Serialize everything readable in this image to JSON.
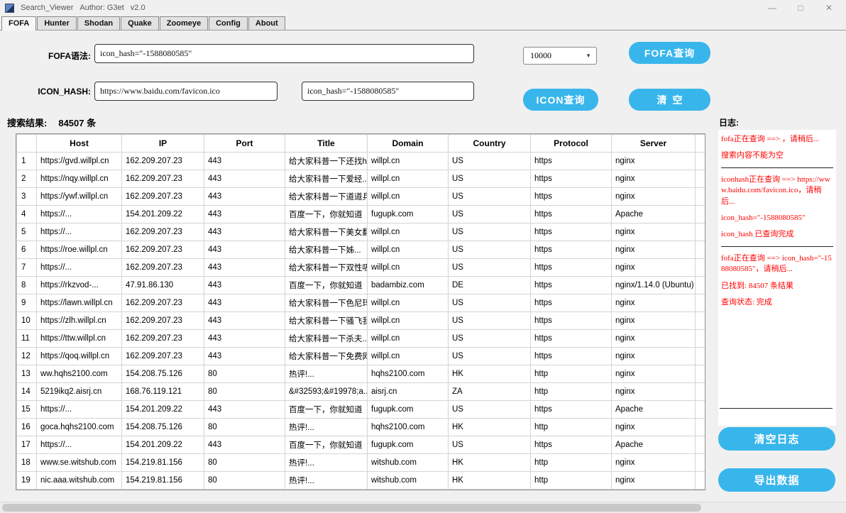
{
  "colors": {
    "accent": "#38b6ec",
    "log_red": "#ff0000"
  },
  "icons": {
    "minimize": "—",
    "maximize": "□",
    "close": "✕",
    "dropdown": "▼"
  },
  "titlebar": {
    "app_name": "Search_Viewer",
    "author": "Author: G3et",
    "version": "v2.0"
  },
  "tabs": [
    {
      "label": "FOFA",
      "active": true
    },
    {
      "label": "Hunter",
      "active": false
    },
    {
      "label": "Shodan",
      "active": false
    },
    {
      "label": "Quake",
      "active": false
    },
    {
      "label": "Zoomeye",
      "active": false
    },
    {
      "label": "Config",
      "active": false
    },
    {
      "label": "About",
      "active": false
    }
  ],
  "form": {
    "fofa_label": "FOFA语法:",
    "fofa_value": "icon_hash=\"-1588080585\"",
    "page_size": "10000",
    "fofa_button": "FOFA查询",
    "icon_label": "ICON_HASH:",
    "icon_url_value": "https://www.baidu.com/favicon.ico",
    "icon_hash_value": "icon_hash=\"-1588080585\"",
    "icon_button": "ICON查询",
    "clear_button": "清空"
  },
  "results": {
    "label": "搜索结果:",
    "count": "84507 条"
  },
  "table": {
    "columns": [
      "Host",
      "IP",
      "Port",
      "Title",
      "Domain",
      "Country",
      "Protocol",
      "Server"
    ],
    "rows": [
      [
        "https://gvd.willpl.cn",
        "162.209.207.23",
        "443",
        "给大家科普一下还找h...",
        "willpl.cn",
        "US",
        "https",
        "nginx"
      ],
      [
        "https://nqy.willpl.cn",
        "162.209.207.23",
        "443",
        "给大家科普一下爱经...",
        "willpl.cn",
        "US",
        "https",
        "nginx"
      ],
      [
        "https://ywf.willpl.cn",
        "162.209.207.23",
        "443",
        "给大家科普一下道道兵...",
        "willpl.cn",
        "US",
        "https",
        "nginx"
      ],
      [
        "https://...",
        "154.201.209.22",
        "443",
        "百度一下，你就知道",
        "fugupk.com",
        "US",
        "https",
        "Apache"
      ],
      [
        "https://...",
        "162.209.207.23",
        "443",
        "给大家科普一下美女翻...",
        "willpl.cn",
        "US",
        "https",
        "nginx"
      ],
      [
        "https://roe.willpl.cn",
        "162.209.207.23",
        "443",
        "给大家科普一下姊...",
        "willpl.cn",
        "US",
        "https",
        "nginx"
      ],
      [
        "https://...",
        "162.209.207.23",
        "443",
        "给大家科普一下双性吸...",
        "willpl.cn",
        "US",
        "https",
        "nginx"
      ],
      [
        "https://rkzvod-...",
        "47.91.86.130",
        "443",
        "百度一下，你就知道",
        "badambiz.com",
        "DE",
        "https",
        "nginx/1.14.0 (Ubuntu)"
      ],
      [
        "https://lawn.willpl.cn",
        "162.209.207.23",
        "443",
        "给大家科普一下色尼玛...",
        "willpl.cn",
        "US",
        "https",
        "nginx"
      ],
      [
        "https://zlh.willpl.cn",
        "162.209.207.23",
        "443",
        "给大家科普一下骚飞我...",
        "willpl.cn",
        "US",
        "https",
        "nginx"
      ],
      [
        "https://ttw.willpl.cn",
        "162.209.207.23",
        "443",
        "给大家科普一下杀夫...",
        "willpl.cn",
        "US",
        "https",
        "nginx"
      ],
      [
        "https://qoq.willpl.cn",
        "162.209.207.23",
        "443",
        "给大家科普一下免费网...",
        "willpl.cn",
        "US",
        "https",
        "nginx"
      ],
      [
        "ww.hqhs2100.com",
        "154.208.75.126",
        "80",
        "热评!...",
        "hqhs2100.com",
        "HK",
        "http",
        "nginx"
      ],
      [
        "5219ikq2.aisrj.cn",
        "168.76.119.121",
        "80",
        "&#32593;&#19978;a...",
        "aisrj.cn",
        "ZA",
        "http",
        "nginx"
      ],
      [
        "https://...",
        "154.201.209.22",
        "443",
        "百度一下，你就知道",
        "fugupk.com",
        "US",
        "https",
        "Apache"
      ],
      [
        "goca.hqhs2100.com",
        "154.208.75.126",
        "80",
        "热评!...",
        "hqhs2100.com",
        "HK",
        "http",
        "nginx"
      ],
      [
        "https://...",
        "154.201.209.22",
        "443",
        "百度一下，你就知道",
        "fugupk.com",
        "US",
        "https",
        "Apache"
      ],
      [
        "www.se.witshub.com",
        "154.219.81.156",
        "80",
        "热评!...",
        "witshub.com",
        "HK",
        "http",
        "nginx"
      ],
      [
        "nic.aaa.witshub.com",
        "154.219.81.156",
        "80",
        "热评!...",
        "witshub.com",
        "HK",
        "http",
        "nginx"
      ]
    ]
  },
  "log": {
    "label": "日志:",
    "entries": [
      {
        "text": "fofa正在查询 ==> ，请稍后...",
        "divider": false
      },
      {
        "text": "搜索内容不能为空",
        "divider": true
      },
      {
        "text": "iconhash正在查询 ==> https://www.baidu.com/favicon.ico，请稍后...",
        "divider": false
      },
      {
        "text": "icon_hash=\"-1588080585\"",
        "divider": false
      },
      {
        "text": "icon_hash 已查询完成",
        "divider": true
      },
      {
        "text": "fofa正在查询 ==> icon_hash=\"-1588080585\"，请稍后...",
        "divider": false
      },
      {
        "text": "已找到: 84507 条结果",
        "divider": false
      },
      {
        "text": "查询状态: 完成",
        "divider": false
      }
    ],
    "clear_button": "清空日志",
    "export_button": "导出数据"
  }
}
